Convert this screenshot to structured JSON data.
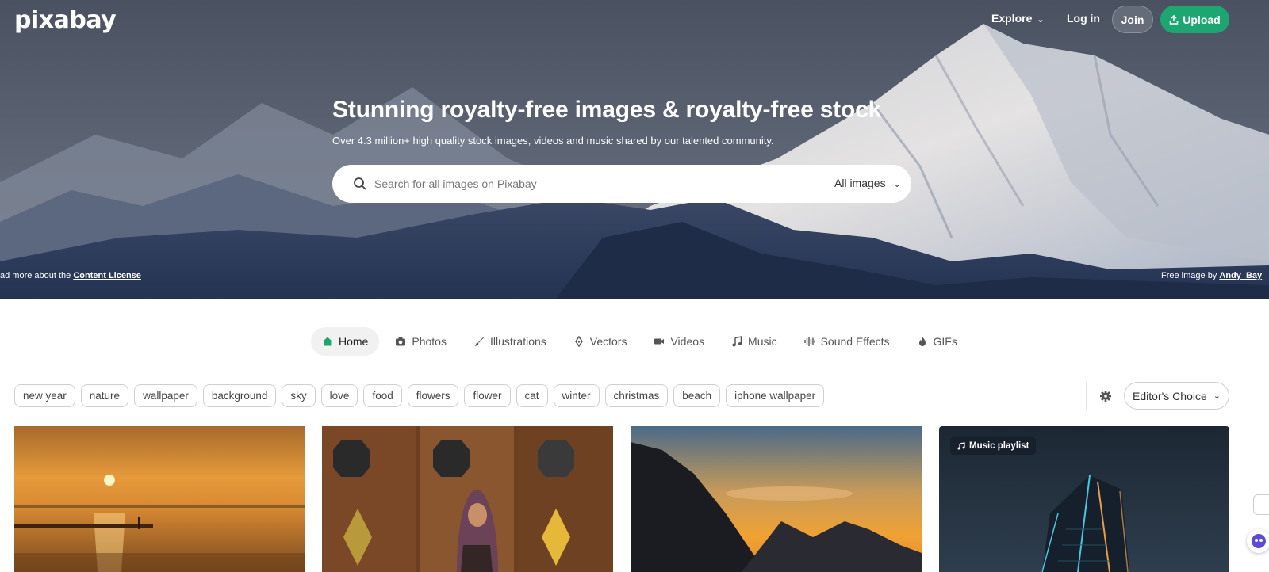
{
  "header": {
    "logo": "pixabay",
    "explore_label": "Explore",
    "login_label": "Log in",
    "join_label": "Join",
    "upload_label": "Upload"
  },
  "hero": {
    "title": "Stunning royalty-free images & royalty-free stock",
    "subtitle": "Over 4.3 million+ high quality stock images, videos and music shared by our talented community.",
    "search_placeholder": "Search for all images on Pixabay",
    "search_filter": "All images",
    "license_prefix": "ad more about the ",
    "license_link": "Content License",
    "credit_prefix": "Free image by ",
    "credit_author": "Andy_Bay"
  },
  "tabs": [
    {
      "label": "Home",
      "icon": "home-icon",
      "active": true
    },
    {
      "label": "Photos",
      "icon": "camera-icon"
    },
    {
      "label": "Illustrations",
      "icon": "brush-icon"
    },
    {
      "label": "Vectors",
      "icon": "pen-nib-icon"
    },
    {
      "label": "Videos",
      "icon": "video-camera-icon"
    },
    {
      "label": "Music",
      "icon": "music-note-icon"
    },
    {
      "label": "Sound Effects",
      "icon": "waveform-icon"
    },
    {
      "label": "GIFs",
      "icon": "flame-icon"
    }
  ],
  "tags": [
    "new year",
    "nature",
    "wallpaper",
    "background",
    "sky",
    "love",
    "food",
    "flowers",
    "flower",
    "cat",
    "winter",
    "christmas",
    "beach",
    "iphone wallpaper"
  ],
  "sort": {
    "selected": "Editor's Choice"
  },
  "cards": [
    {
      "badge": ""
    },
    {
      "badge": ""
    },
    {
      "badge": ""
    },
    {
      "badge": "Music playlist"
    }
  ],
  "colors": {
    "accent": "#1ea672"
  }
}
